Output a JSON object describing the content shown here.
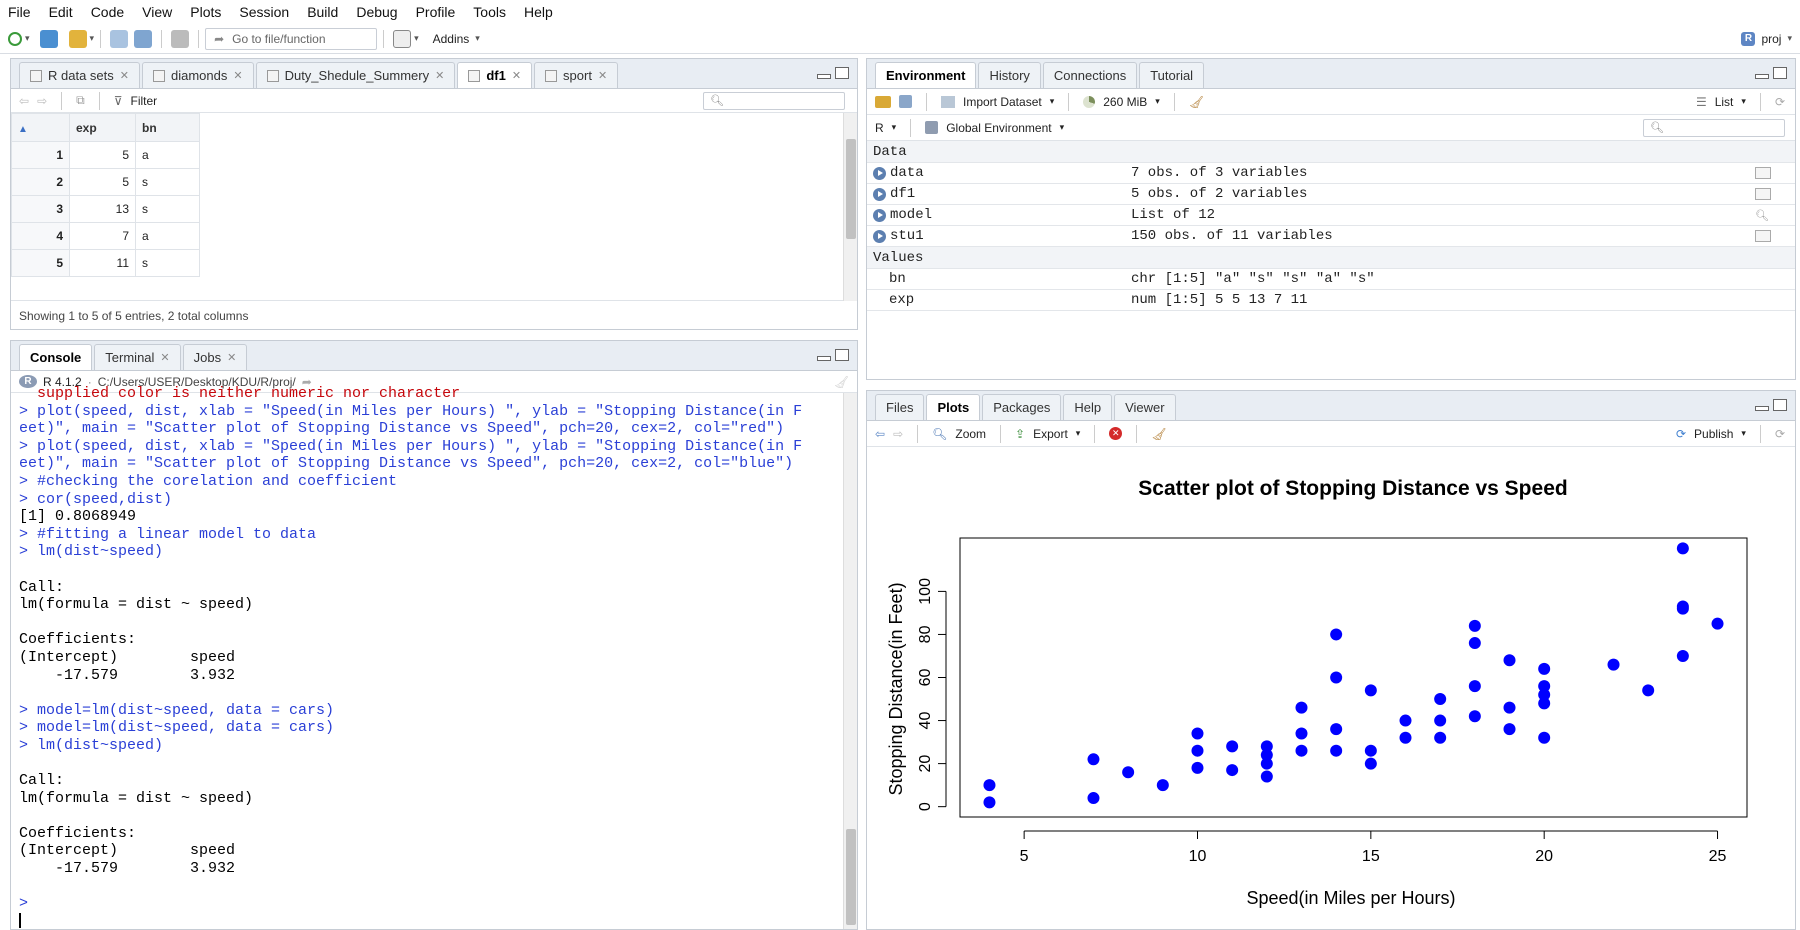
{
  "menu": [
    "File",
    "Edit",
    "Code",
    "View",
    "Plots",
    "Session",
    "Build",
    "Debug",
    "Profile",
    "Tools",
    "Help"
  ],
  "toolbar": {
    "goto_placeholder": "Go to file/function",
    "addins": "Addins",
    "project": "proj"
  },
  "source": {
    "tabs": [
      "R data sets",
      "diamonds",
      "Duty_Shedule_Summery",
      "df1",
      "sport"
    ],
    "active_tab": "df1",
    "filter_label": "Filter",
    "columns": [
      "exp",
      "bn"
    ],
    "rows": [
      {
        "n": "1",
        "exp": "5",
        "bn": "a"
      },
      {
        "n": "2",
        "exp": "5",
        "bn": "s"
      },
      {
        "n": "3",
        "exp": "13",
        "bn": "s"
      },
      {
        "n": "4",
        "exp": "7",
        "bn": "a"
      },
      {
        "n": "5",
        "exp": "11",
        "bn": "s"
      }
    ],
    "footer": "Showing 1 to 5 of 5 entries, 2 total columns"
  },
  "console": {
    "tabs": [
      "Console",
      "Terminal",
      "Jobs"
    ],
    "version": "R 4.1.2",
    "path": "C:/Users/USER/Desktop/KDU/R/proj/",
    "lines": [
      {
        "t": "err",
        "s": "  supplied color is neither numeric nor character"
      },
      {
        "t": "cmd",
        "s": "> plot(speed, dist, xlab = \"Speed(in Miles per Hours) \", ylab = \"Stopping Distance(in F"
      },
      {
        "t": "cmd",
        "s": "eet)\", main = \"Scatter plot of Stopping Distance vs Speed\", pch=20, cex=2, col=\"red\")"
      },
      {
        "t": "cmd",
        "s": "> plot(speed, dist, xlab = \"Speed(in Miles per Hours) \", ylab = \"Stopping Distance(in F"
      },
      {
        "t": "cmd",
        "s": "eet)\", main = \"Scatter plot of Stopping Distance vs Speed\", pch=20, cex=2, col=\"blue\")"
      },
      {
        "t": "cmd",
        "s": "> #checking the corelation and coefficient"
      },
      {
        "t": "cmd",
        "s": "> cor(speed,dist)"
      },
      {
        "t": "out",
        "s": "[1] 0.8068949"
      },
      {
        "t": "cmd",
        "s": "> #fitting a linear model to data"
      },
      {
        "t": "cmd",
        "s": "> lm(dist~speed)"
      },
      {
        "t": "out",
        "s": ""
      },
      {
        "t": "out",
        "s": "Call:"
      },
      {
        "t": "out",
        "s": "lm(formula = dist ~ speed)"
      },
      {
        "t": "out",
        "s": ""
      },
      {
        "t": "out",
        "s": "Coefficients:"
      },
      {
        "t": "out",
        "s": "(Intercept)        speed  "
      },
      {
        "t": "out",
        "s": "    -17.579        3.932  "
      },
      {
        "t": "out",
        "s": ""
      },
      {
        "t": "cmd",
        "s": "> model=lm(dist~speed, data = cars)"
      },
      {
        "t": "cmd",
        "s": "> model=lm(dist~speed, data = cars)"
      },
      {
        "t": "cmd",
        "s": "> lm(dist~speed)"
      },
      {
        "t": "out",
        "s": ""
      },
      {
        "t": "out",
        "s": "Call:"
      },
      {
        "t": "out",
        "s": "lm(formula = dist ~ speed)"
      },
      {
        "t": "out",
        "s": ""
      },
      {
        "t": "out",
        "s": "Coefficients:"
      },
      {
        "t": "out",
        "s": "(Intercept)        speed  "
      },
      {
        "t": "out",
        "s": "    -17.579        3.932  "
      },
      {
        "t": "out",
        "s": ""
      },
      {
        "t": "cmd",
        "s": "> "
      }
    ]
  },
  "environment": {
    "tabs": [
      "Environment",
      "History",
      "Connections",
      "Tutorial"
    ],
    "import_label": "Import Dataset",
    "memory": "260 MiB",
    "view_mode": "List",
    "lang": "R",
    "scope": "Global Environment",
    "data_header": "Data",
    "data": [
      {
        "name": "data",
        "value": "7 obs. of 3 variables"
      },
      {
        "name": "df1",
        "value": "5 obs. of 2 variables"
      },
      {
        "name": "model",
        "value": "List of  12"
      },
      {
        "name": "stu1",
        "value": "150 obs. of 11 variables"
      }
    ],
    "values_header": "Values",
    "values": [
      {
        "name": "bn",
        "value": "chr [1:5] \"a\" \"s\" \"s\" \"a\" \"s\""
      },
      {
        "name": "exp",
        "value": "num [1:5] 5 5 13 7 11"
      }
    ]
  },
  "files": {
    "tabs": [
      "Files",
      "Plots",
      "Packages",
      "Help",
      "Viewer"
    ],
    "active_tab": "Plots",
    "zoom": "Zoom",
    "export": "Export",
    "publish": "Publish"
  },
  "chart_data": {
    "type": "scatter",
    "title": "Scatter plot of Stopping Distance vs Speed",
    "xlabel": "Speed(in Miles per Hours)",
    "ylabel": "Stopping Distance(in Feet)",
    "xlim": [
      4,
      25
    ],
    "ylim": [
      0,
      120
    ],
    "xticks": [
      5,
      10,
      15,
      20,
      25
    ],
    "yticks": [
      0,
      20,
      40,
      60,
      80,
      100
    ],
    "color": "#0000ff",
    "points": [
      [
        4,
        2
      ],
      [
        4,
        10
      ],
      [
        7,
        4
      ],
      [
        7,
        22
      ],
      [
        8,
        16
      ],
      [
        9,
        10
      ],
      [
        10,
        18
      ],
      [
        10,
        26
      ],
      [
        10,
        34
      ],
      [
        11,
        17
      ],
      [
        11,
        28
      ],
      [
        12,
        14
      ],
      [
        12,
        20
      ],
      [
        12,
        24
      ],
      [
        12,
        28
      ],
      [
        13,
        26
      ],
      [
        13,
        34
      ],
      [
        13,
        46
      ],
      [
        14,
        26
      ],
      [
        14,
        36
      ],
      [
        14,
        60
      ],
      [
        14,
        80
      ],
      [
        15,
        20
      ],
      [
        15,
        26
      ],
      [
        15,
        54
      ],
      [
        16,
        32
      ],
      [
        16,
        40
      ],
      [
        17,
        32
      ],
      [
        17,
        40
      ],
      [
        17,
        50
      ],
      [
        18,
        42
      ],
      [
        18,
        56
      ],
      [
        18,
        76
      ],
      [
        18,
        84
      ],
      [
        19,
        36
      ],
      [
        19,
        46
      ],
      [
        19,
        68
      ],
      [
        20,
        32
      ],
      [
        20,
        48
      ],
      [
        20,
        52
      ],
      [
        20,
        56
      ],
      [
        20,
        64
      ],
      [
        22,
        66
      ],
      [
        23,
        54
      ],
      [
        24,
        70
      ],
      [
        24,
        92
      ],
      [
        24,
        93
      ],
      [
        24,
        120
      ],
      [
        25,
        85
      ]
    ]
  }
}
